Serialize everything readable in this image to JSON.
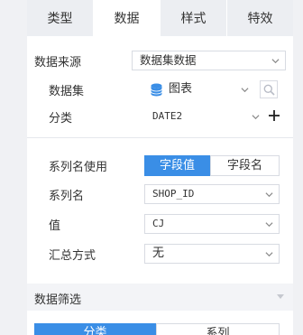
{
  "tabs": [
    {
      "label": "类型",
      "active": false
    },
    {
      "label": "数据",
      "active": true
    },
    {
      "label": "样式",
      "active": false
    },
    {
      "label": "特效",
      "active": false
    }
  ],
  "data_source": {
    "label": "数据来源",
    "value": "数据集数据"
  },
  "dataset": {
    "label": "数据集",
    "value": "图表",
    "icon": "database-icon",
    "search_icon": "search-icon"
  },
  "category": {
    "label": "分类",
    "value": "DATE2",
    "add_icon": "plus-icon"
  },
  "series_name_use": {
    "label": "系列名使用",
    "options": [
      "字段值",
      "字段名"
    ],
    "selected": "字段值"
  },
  "series_name": {
    "label": "系列名",
    "value": "SHOP_ID"
  },
  "value_field": {
    "label": "值",
    "value": "CJ"
  },
  "summary": {
    "label": "汇总方式",
    "value": "无"
  },
  "data_filter": {
    "label": "数据筛选",
    "tabs": [
      "分类",
      "系列"
    ]
  },
  "colors": {
    "accent": "#3a8ee6",
    "tab_bg": "#eceef2",
    "border": "#d8dbe2"
  }
}
